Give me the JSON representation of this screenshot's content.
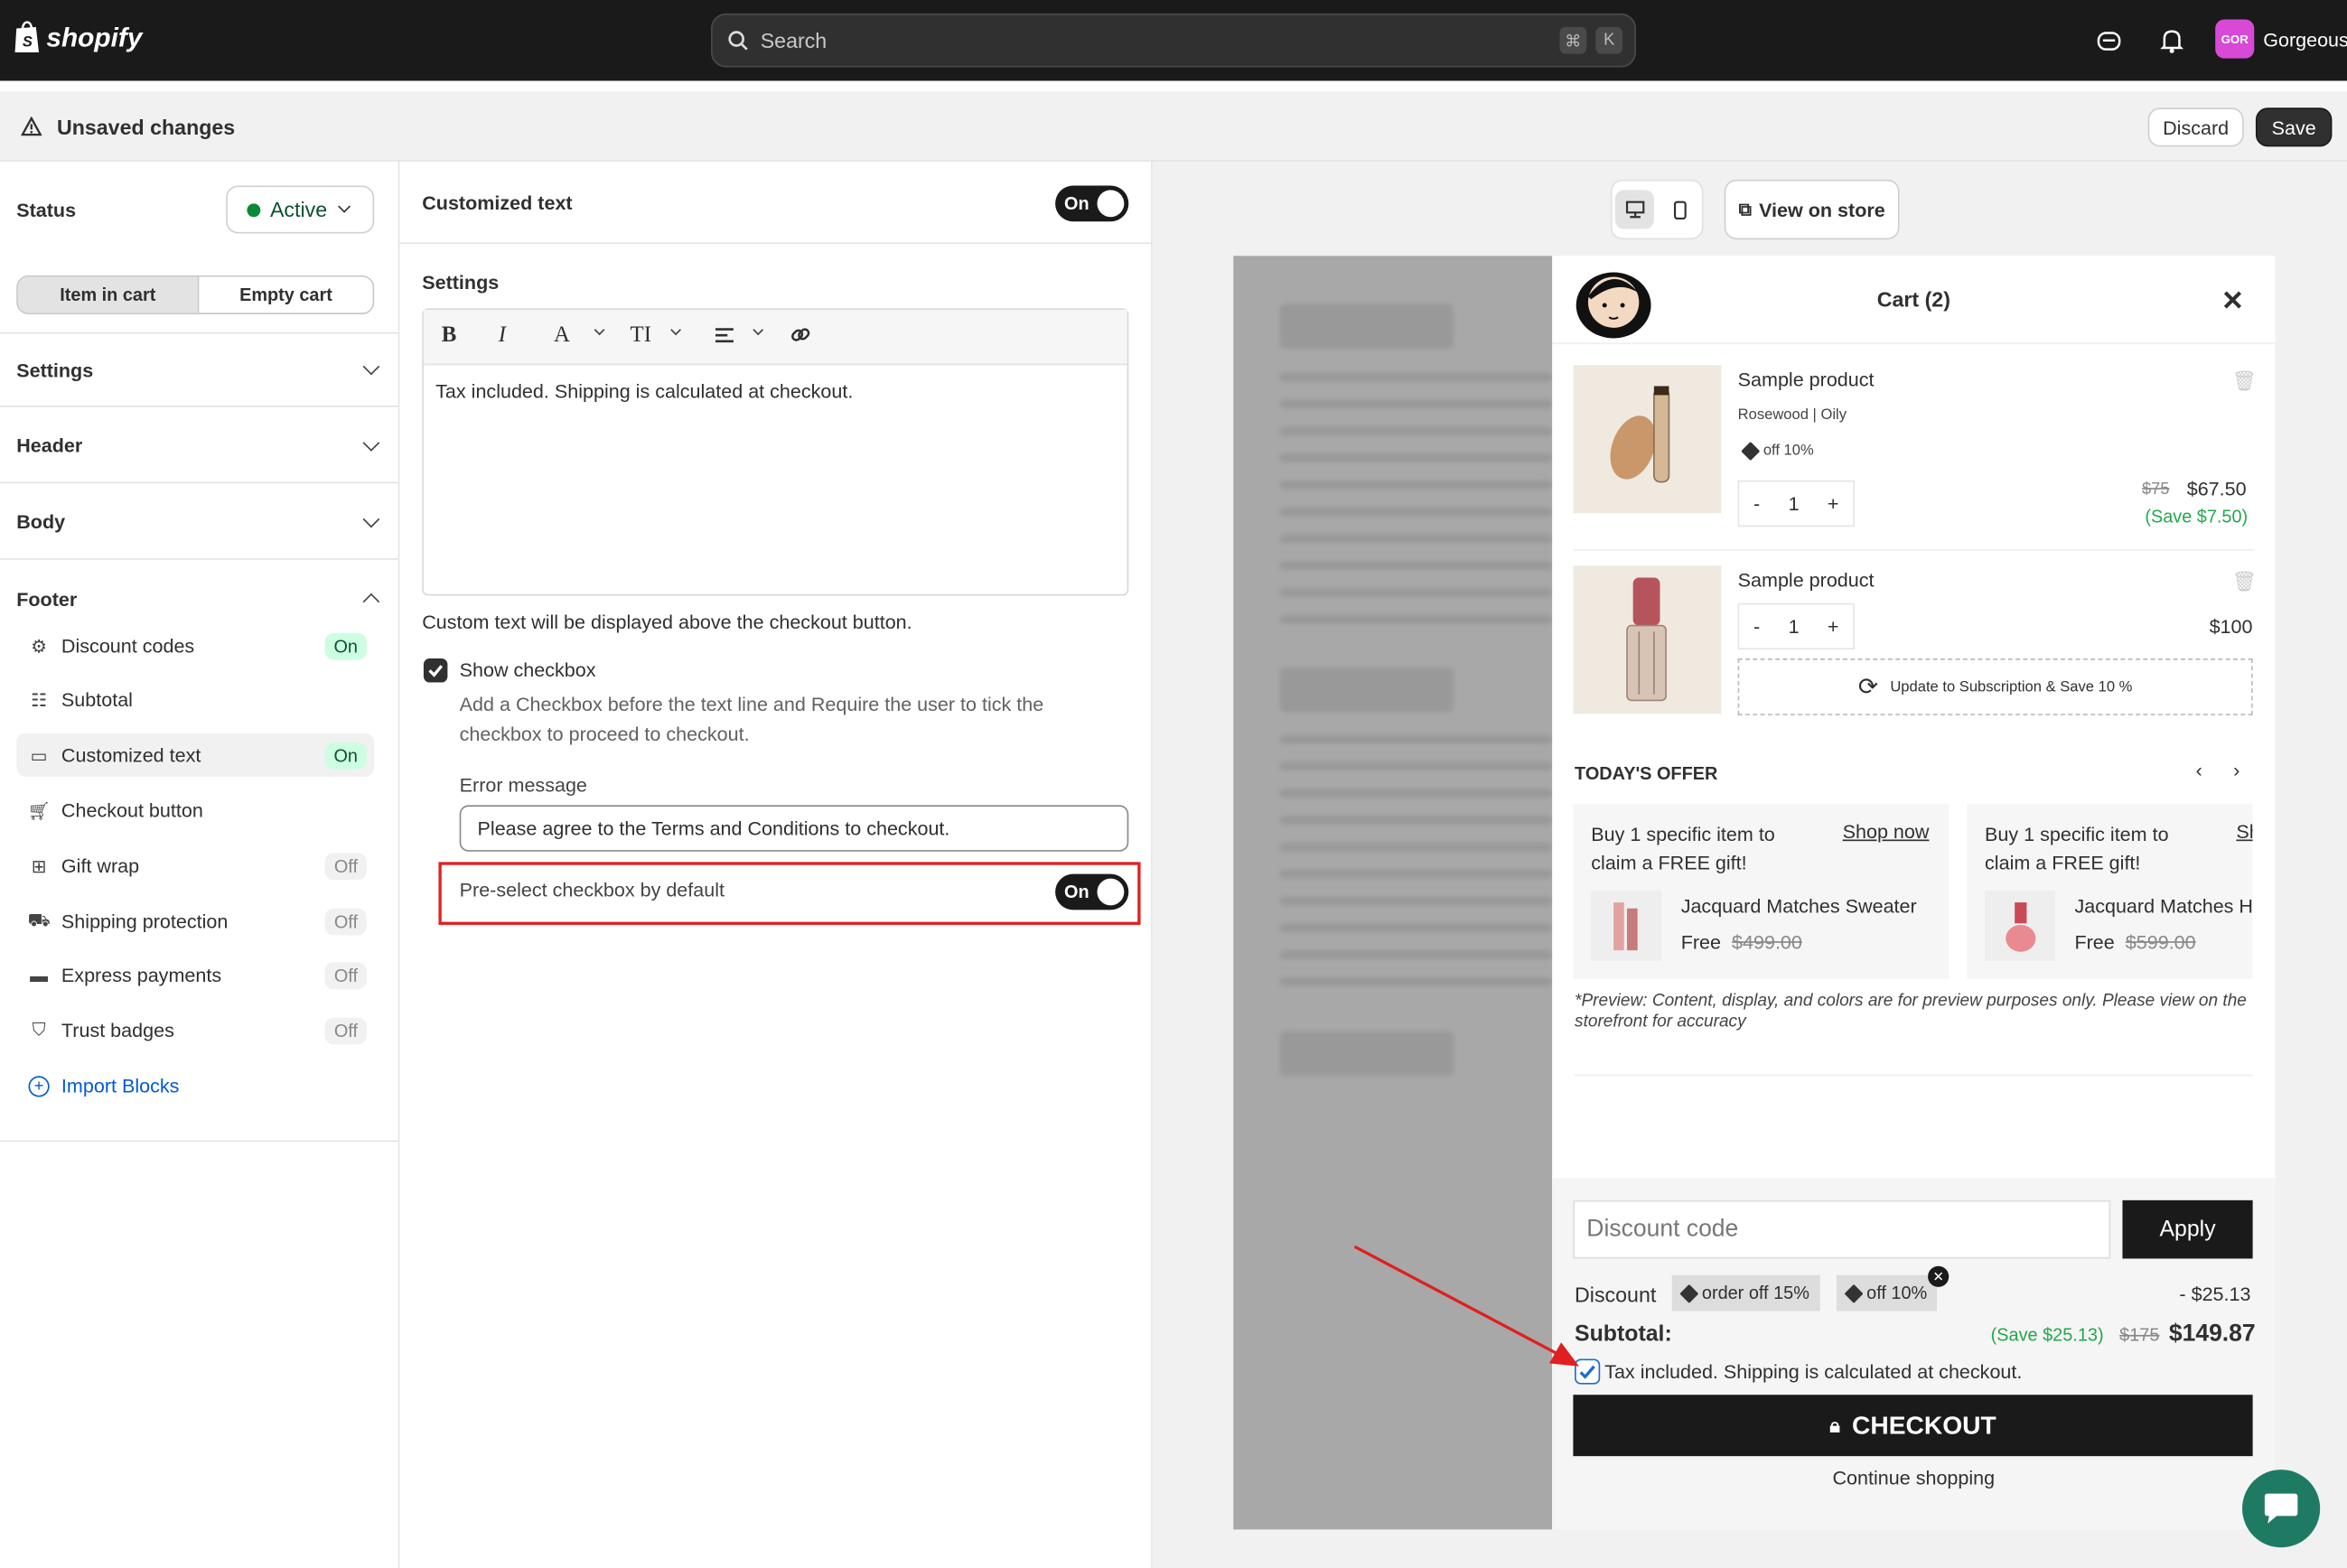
{
  "topbar": {
    "brand": "shopify",
    "search_placeholder": "Search",
    "kbd1": "⌘",
    "kbd2": "K",
    "store_initials": "GOR",
    "store_name": "Gorgeous"
  },
  "unsaved": {
    "title": "Unsaved changes",
    "discard": "Discard",
    "save": "Save"
  },
  "left": {
    "status_label": "Status",
    "status_value": "Active",
    "seg_item": "Item in cart",
    "seg_empty": "Empty cart",
    "settings": "Settings",
    "header": "Header",
    "body": "Body",
    "footer": "Footer",
    "footer_items": [
      {
        "label": "Discount codes",
        "state": "On"
      },
      {
        "label": "Subtotal",
        "state": ""
      },
      {
        "label": "Customized text",
        "state": "On"
      },
      {
        "label": "Checkout button",
        "state": ""
      },
      {
        "label": "Gift wrap",
        "state": "Off"
      },
      {
        "label": "Shipping protection",
        "state": "Off"
      },
      {
        "label": "Express payments",
        "state": "Off"
      },
      {
        "label": "Trust badges",
        "state": "Off"
      }
    ],
    "import": "Import Blocks"
  },
  "mid": {
    "title": "Customized text",
    "toggle": "On",
    "settings": "Settings",
    "toolbar": {
      "bold": "B",
      "italic": "I",
      "font": "A",
      "size": "TI"
    },
    "editor_text": "Tax included. Shipping is calculated at checkout.",
    "help": "Custom text will be displayed above the checkout button.",
    "show_checkbox": "Show checkbox",
    "checkbox_desc": "Add a Checkbox before the text line and Require the user to tick the checkbox to proceed to checkout.",
    "error_label": "Error message",
    "error_value": "Please agree to the Terms and Conditions to checkout.",
    "preselect": "Pre-select checkbox by default",
    "preselect_toggle": "On"
  },
  "preview": {
    "view_on_store": "View on store",
    "cart_title": "Cart (2)",
    "items": [
      {
        "name": "Sample product",
        "variant": "Rosewood | Oily",
        "discount": "off 10%",
        "qty": "1",
        "old_price": "$75",
        "price": "$67.50",
        "save": "(Save $7.50)"
      },
      {
        "name": "Sample product",
        "qty": "1",
        "price": "$100",
        "subscription": "Update to Subscription & Save 10 %"
      }
    ],
    "offer_title": "TODAY'S OFFER",
    "offers": [
      {
        "text": "Buy 1 specific item to claim a FREE gift!",
        "cta": "Shop now",
        "product": "Jacquard Matches Sweater",
        "free": "Free",
        "old": "$499.00"
      },
      {
        "text": "Buy 1 specific item to claim a FREE gift!",
        "cta": "Sh",
        "product": "Jacquard Matches H",
        "free": "Free",
        "old": "$599.00"
      }
    ],
    "preview_note": "*Preview: Content, display, and colors are for preview purposes only. Please view on the storefront for accuracy",
    "discount_placeholder": "Discount code",
    "apply": "Apply",
    "discount_label": "Discount",
    "disc_tag1": "order off 15%",
    "disc_tag2": "off 10%",
    "discount_amount": "- $25.13",
    "subtotal_label": "Subtotal:",
    "subtotal_save": "(Save $25.13)",
    "subtotal_old": "$175",
    "subtotal": "$149.87",
    "tax_text": "Tax included. Shipping is calculated at checkout.",
    "checkout": "CHECKOUT",
    "continue": "Continue shopping"
  },
  "colors": {
    "accent_green": "#29845a",
    "save_green": "#22a84a",
    "highlight_red": "#e02020",
    "dark": "#1a1a1a",
    "link_blue": "#005bd3"
  }
}
